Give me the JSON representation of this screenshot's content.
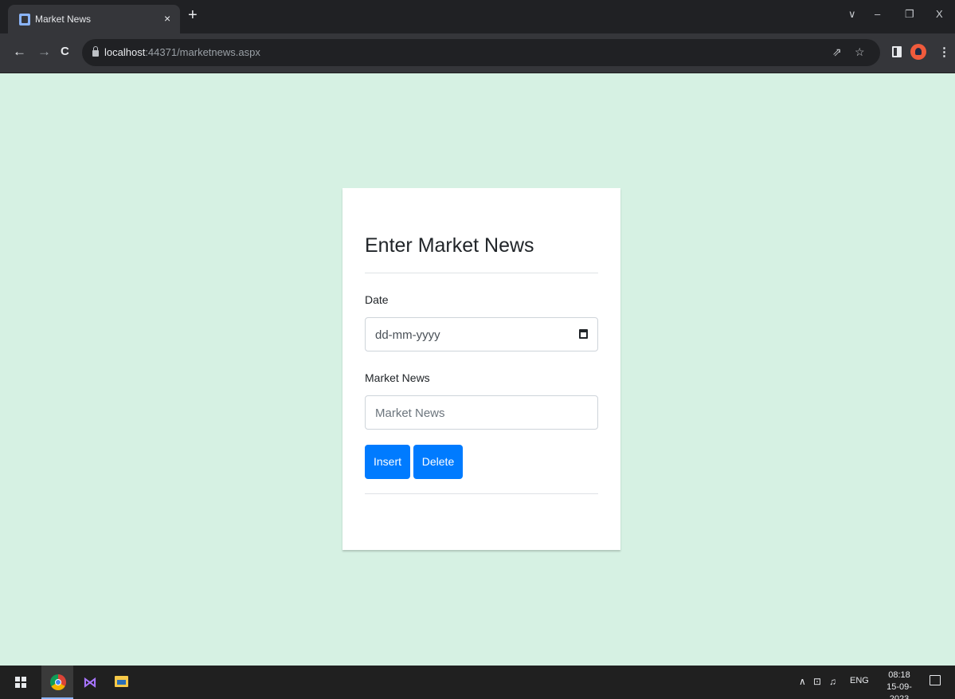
{
  "browser": {
    "tab_title": "Market News",
    "tab_close": "×",
    "new_tab": "+",
    "url_host": "localhost",
    "url_path": ":44371/marketnews.aspx",
    "window_controls": {
      "tabsearch": "∨",
      "minimize": "–",
      "restore": "❐",
      "close": "X"
    },
    "nav": {
      "back": "←",
      "forward": "→",
      "reload": "C"
    },
    "toolbar_icons": {
      "share": "⇗",
      "bookmark": "☆",
      "menu": "⋮"
    }
  },
  "form": {
    "title": "Enter Market News",
    "date_label": "Date",
    "date_value": "dd-mm-yyyy",
    "news_label": "Market News",
    "news_placeholder": "Market News",
    "insert_label": "Insert",
    "delete_label": "Delete"
  },
  "taskbar": {
    "tray_chevron": "∧",
    "tray_network": "⊡",
    "tray_volume": "♫",
    "language": "ENG",
    "time": "08:18",
    "date": "15-09-2023",
    "vs_glyph": "⋈"
  },
  "colors": {
    "page_background": "#d6f1e3",
    "button_primary": "#007bff",
    "card_background": "#ffffff"
  }
}
